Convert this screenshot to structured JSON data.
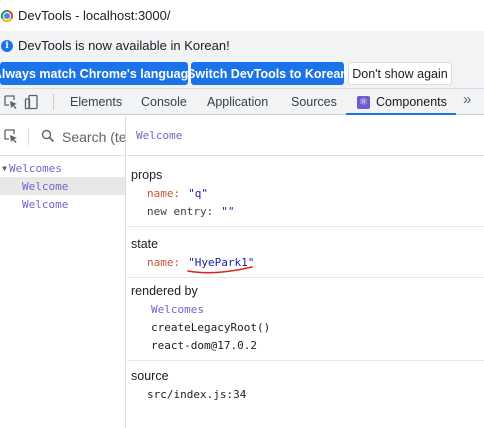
{
  "window": {
    "title": "DevTools - localhost:3000/"
  },
  "infobar": {
    "message": "DevTools is now available in Korean!"
  },
  "buttons": {
    "always_match": "Always match Chrome's language",
    "switch": "Switch DevTools to Korean",
    "dont_show": "Don't show again"
  },
  "tabs": [
    {
      "label": "Elements"
    },
    {
      "label": "Console"
    },
    {
      "label": "Application"
    },
    {
      "label": "Sources"
    },
    {
      "label": "Components",
      "active": true
    }
  ],
  "tab_overflow": "»",
  "search": {
    "placeholder": "Search (te"
  },
  "tree": [
    {
      "label": "Welcomes",
      "expanded": true
    },
    {
      "label": "Welcome",
      "selected": true
    },
    {
      "label": "Welcome"
    }
  ],
  "inspector": {
    "component_name": "Welcome",
    "props": {
      "title": "props",
      "items": [
        {
          "key": "name:",
          "value": "\"q\""
        },
        {
          "key": "new entry:",
          "value": "\"\""
        }
      ]
    },
    "state": {
      "title": "state",
      "items": [
        {
          "key": "name:",
          "value": "\"HyePark1\""
        }
      ]
    },
    "rendered_by": {
      "title": "rendered by",
      "items": [
        "Welcomes",
        "createLegacyRoot()",
        "react-dom@17.0.2"
      ]
    },
    "source": {
      "title": "source",
      "value": "src/index.js:34"
    }
  },
  "colors": {
    "accent": "#1a73e8",
    "component_purple": "#7b5fc9",
    "prop_key": "#c8533a",
    "prop_value": "#1a1aa6",
    "annotation_red": "#e0221d"
  },
  "icons": [
    "chrome-logo-icon",
    "info-icon",
    "inspect-element-icon",
    "device-toolbar-icon",
    "react-components-icon",
    "more-tabs-icon",
    "search-icon"
  ]
}
